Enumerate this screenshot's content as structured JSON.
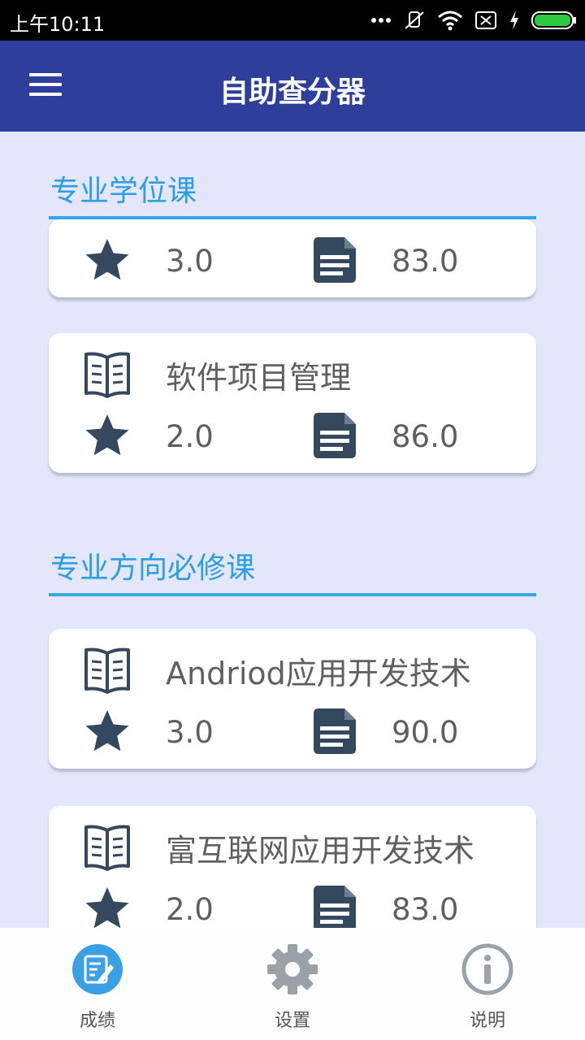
{
  "status_bar": {
    "time": "上午10:11",
    "icons": [
      "more-dots-icon",
      "mute-icon",
      "wifi-icon",
      "sim-off-icon",
      "charging-icon",
      "battery-icon"
    ],
    "battery_color": "#2ecc40"
  },
  "app_bar": {
    "title": "自助查分器",
    "menu_icon": "menu-icon",
    "background": "#2d3e9b"
  },
  "sections": [
    {
      "title": "专业学位课",
      "courses": [
        {
          "name": "",
          "credit": "3.0",
          "score": "83.0"
        },
        {
          "name": "软件项目管理",
          "credit": "2.0",
          "score": "86.0"
        }
      ]
    },
    {
      "title": "专业方向必修课",
      "courses": [
        {
          "name": "Andriod应用开发技术",
          "credit": "3.0",
          "score": "90.0"
        },
        {
          "name": "富互联网应用开发技术",
          "credit": "2.0",
          "score": "83.0"
        }
      ]
    }
  ],
  "bottom_nav": [
    {
      "label": "成绩",
      "icon": "edit-grades-icon",
      "active": true
    },
    {
      "label": "设置",
      "icon": "gear-icon",
      "active": false
    },
    {
      "label": "说明",
      "icon": "info-icon",
      "active": false
    }
  ],
  "colors": {
    "accent": "#2a9fe2",
    "icon_dark": "#34495e",
    "page_bg": "#e4e6fb"
  }
}
